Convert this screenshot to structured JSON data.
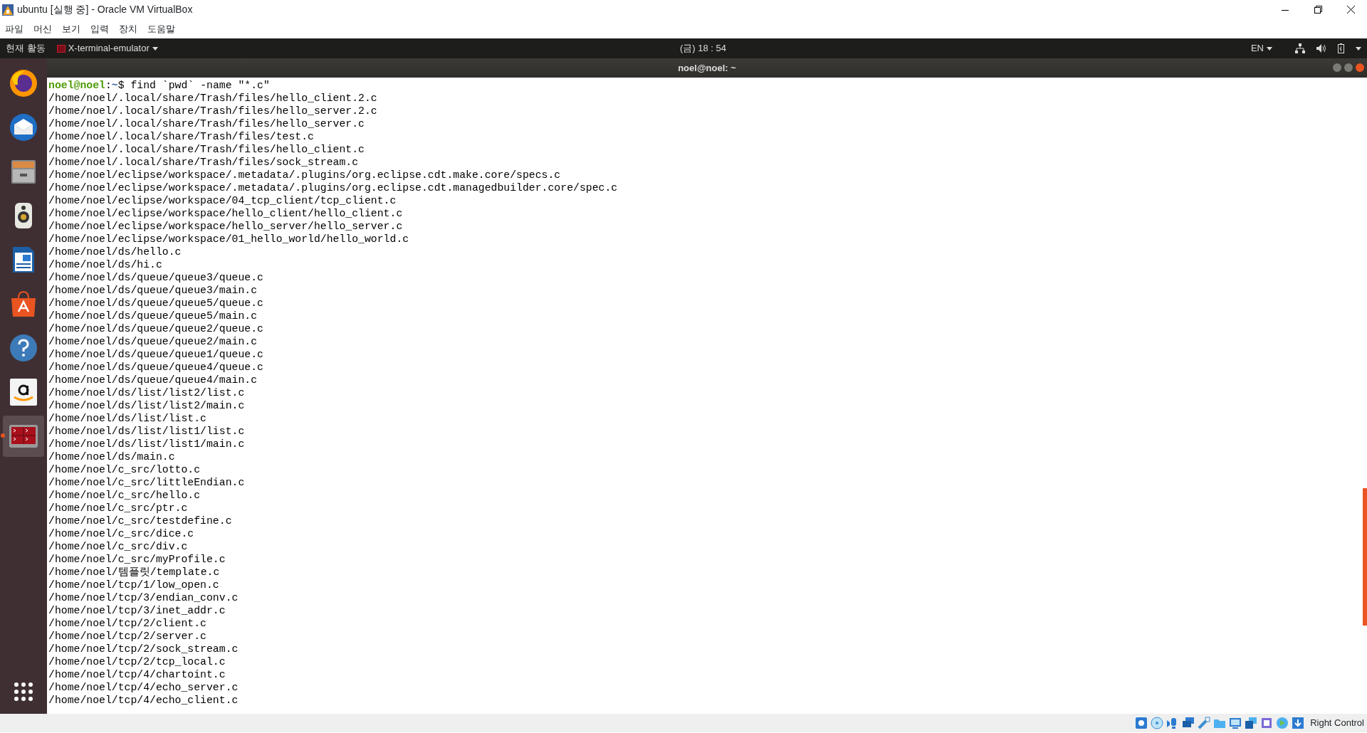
{
  "window": {
    "title": "ubuntu [실행 중] - Oracle VM VirtualBox"
  },
  "menu": [
    "파일",
    "머신",
    "보기",
    "입력",
    "장치",
    "도움말"
  ],
  "top_bar": {
    "activities": "현재 활동",
    "app_menu": "X-terminal-emulator",
    "clock": "(금) 18 : 54",
    "input_method": "EN"
  },
  "dock": {
    "items": [
      {
        "selected": false
      },
      {
        "selected": false
      },
      {
        "selected": false
      },
      {
        "selected": false
      },
      {
        "selected": false
      },
      {
        "selected": false
      },
      {
        "selected": false
      },
      {
        "selected": false
      },
      {
        "selected": true
      }
    ]
  },
  "terminal": {
    "title": "noel@noel: ~",
    "prompt": {
      "user_host": "noel@noel",
      "separator": ":",
      "path": "~",
      "command": "$ find `pwd` -name \"*.c\""
    },
    "output": [
      "/home/noel/.local/share/Trash/files/hello_client.2.c",
      "/home/noel/.local/share/Trash/files/hello_server.2.c",
      "/home/noel/.local/share/Trash/files/hello_server.c",
      "/home/noel/.local/share/Trash/files/test.c",
      "/home/noel/.local/share/Trash/files/hello_client.c",
      "/home/noel/.local/share/Trash/files/sock_stream.c",
      "/home/noel/eclipse/workspace/.metadata/.plugins/org.eclipse.cdt.make.core/specs.c",
      "/home/noel/eclipse/workspace/.metadata/.plugins/org.eclipse.cdt.managedbuilder.core/spec.c",
      "/home/noel/eclipse/workspace/04_tcp_client/tcp_client.c",
      "/home/noel/eclipse/workspace/hello_client/hello_client.c",
      "/home/noel/eclipse/workspace/hello_server/hello_server.c",
      "/home/noel/eclipse/workspace/01_hello_world/hello_world.c",
      "/home/noel/ds/hello.c",
      "/home/noel/ds/hi.c",
      "/home/noel/ds/queue/queue3/queue.c",
      "/home/noel/ds/queue/queue3/main.c",
      "/home/noel/ds/queue/queue5/queue.c",
      "/home/noel/ds/queue/queue5/main.c",
      "/home/noel/ds/queue/queue2/queue.c",
      "/home/noel/ds/queue/queue2/main.c",
      "/home/noel/ds/queue/queue1/queue.c",
      "/home/noel/ds/queue/queue4/queue.c",
      "/home/noel/ds/queue/queue4/main.c",
      "/home/noel/ds/list/list2/list.c",
      "/home/noel/ds/list/list2/main.c",
      "/home/noel/ds/list/list.c",
      "/home/noel/ds/list/list1/list.c",
      "/home/noel/ds/list/list1/main.c",
      "/home/noel/ds/main.c",
      "/home/noel/c_src/lotto.c",
      "/home/noel/c_src/littleEndian.c",
      "/home/noel/c_src/hello.c",
      "/home/noel/c_src/ptr.c",
      "/home/noel/c_src/testdefine.c",
      "/home/noel/c_src/dice.c",
      "/home/noel/c_src/div.c",
      "/home/noel/c_src/myProfile.c",
      "/home/noel/템플릿/template.c",
      "/home/noel/tcp/1/low_open.c",
      "/home/noel/tcp/3/endian_conv.c",
      "/home/noel/tcp/3/inet_addr.c",
      "/home/noel/tcp/2/client.c",
      "/home/noel/tcp/2/server.c",
      "/home/noel/tcp/2/sock_stream.c",
      "/home/noel/tcp/2/tcp_local.c",
      "/home/noel/tcp/4/chartoint.c",
      "/home/noel/tcp/4/echo_server.c",
      "/home/noel/tcp/4/echo_client.c"
    ]
  },
  "status_bar": {
    "host_key": "Right Control"
  }
}
